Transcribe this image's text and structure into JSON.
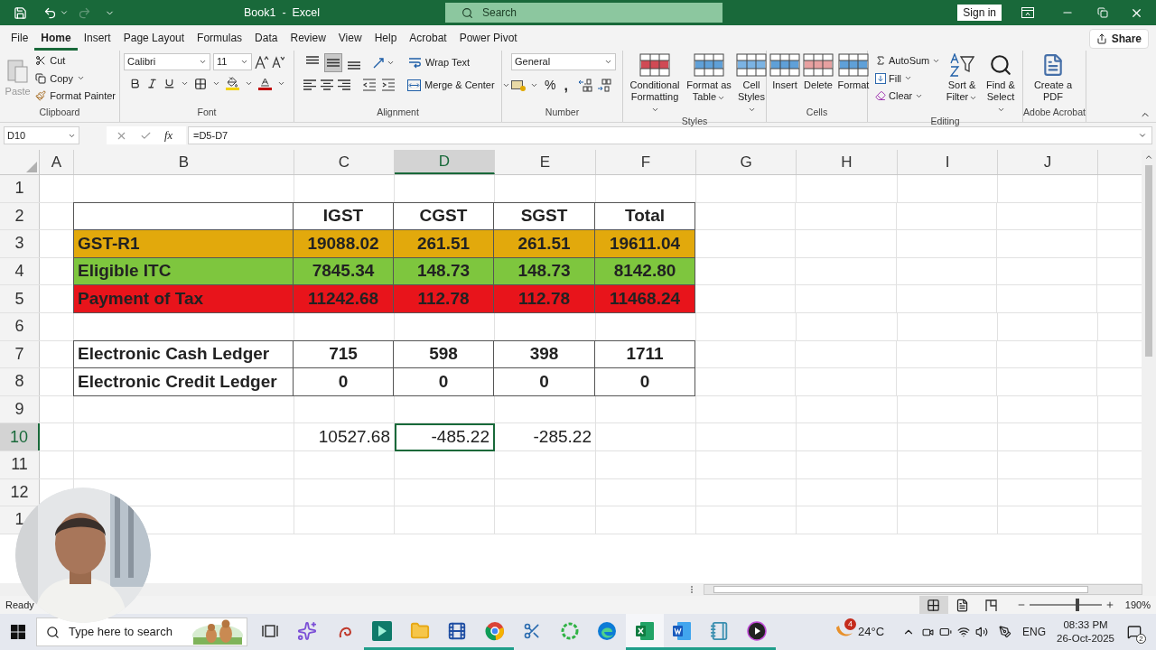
{
  "title_bar": {
    "title": "Book1  -  Excel",
    "search": "Search",
    "sign_in": "Sign in",
    "redo_disabled": true
  },
  "menu_tabs": [
    {
      "label": "File",
      "selected": false
    },
    {
      "label": "Home",
      "selected": true
    },
    {
      "label": "Insert",
      "selected": false
    },
    {
      "label": "Page Layout",
      "selected": false
    },
    {
      "label": "Formulas",
      "selected": false
    },
    {
      "label": "Data",
      "selected": false
    },
    {
      "label": "Review",
      "selected": false
    },
    {
      "label": "View",
      "selected": false
    },
    {
      "label": "Help",
      "selected": false
    },
    {
      "label": "Acrobat",
      "selected": false
    },
    {
      "label": "Power Pivot",
      "selected": false
    }
  ],
  "share": "Share",
  "ribbon": {
    "clipboard": {
      "paste": "Paste",
      "cut": "Cut",
      "copy": "Copy",
      "format_painter": "Format Painter",
      "label": "Clipboard"
    },
    "font": {
      "name": "Calibri",
      "size": "11",
      "label": "Font"
    },
    "alignment": {
      "vertical": [
        {
          "kind": "top",
          "selected": false
        },
        {
          "kind": "middle",
          "selected": true
        },
        {
          "kind": "bottom",
          "selected": false
        }
      ],
      "wrap": "Wrap Text",
      "merge": "Merge & Center",
      "label": "Alignment"
    },
    "number": {
      "format": "General",
      "percent": "%",
      "comma": ",",
      "label": "Number"
    },
    "styles": {
      "conditional": "Conditional Formatting",
      "format_table": "Format as Table",
      "cell_styles": "Cell Styles",
      "label": "Styles"
    },
    "cells": {
      "insert": "Insert",
      "delete": "Delete",
      "format": "Format",
      "label": "Cells"
    },
    "editing": {
      "autosum": "AutoSum",
      "fill": "Fill",
      "clear": "Clear",
      "sort": "Sort & Filter",
      "find": "Find & Select",
      "label": "Editing"
    },
    "acrobat": {
      "create": "Create a PDF",
      "label": "Adobe Acrobat"
    }
  },
  "formula_bar": {
    "name_box": "D10",
    "fx": "fx",
    "formula": "=D5-D7"
  },
  "sheet": {
    "columns": [
      {
        "label": "A",
        "selected": false
      },
      {
        "label": "B",
        "selected": false
      },
      {
        "label": "C",
        "selected": false
      },
      {
        "label": "D",
        "selected": true
      },
      {
        "label": "E",
        "selected": false
      },
      {
        "label": "F",
        "selected": false
      },
      {
        "label": "G",
        "selected": false
      },
      {
        "label": "H",
        "selected": false
      },
      {
        "label": "I",
        "selected": false
      },
      {
        "label": "J",
        "selected": false
      }
    ],
    "rows": [
      {
        "number": "1",
        "selected": false,
        "bordered": false
      },
      {
        "number": "2",
        "selected": false,
        "bordered": true,
        "cells": [
          {
            "text": "IGST",
            "kind": "value",
            "selected": false
          },
          {
            "text": "CGST",
            "kind": "value",
            "selected": false
          },
          {
            "text": "SGST",
            "kind": "value",
            "selected": false
          },
          {
            "text": "Total",
            "kind": "value",
            "selected": false
          }
        ]
      },
      {
        "number": "3",
        "selected": false,
        "bordered": true,
        "color": "#e2a90c",
        "label": "GST-R1",
        "cells": [
          {
            "text": "19088.02",
            "kind": "value",
            "selected": false
          },
          {
            "text": "261.51",
            "kind": "value",
            "selected": false
          },
          {
            "text": "261.51",
            "kind": "value",
            "selected": false
          },
          {
            "text": "19611.04",
            "kind": "value",
            "selected": false
          }
        ]
      },
      {
        "number": "4",
        "selected": false,
        "bordered": true,
        "color": "#7ec63e",
        "label": "Eligible ITC",
        "cells": [
          {
            "text": "7845.34",
            "kind": "value",
            "selected": false
          },
          {
            "text": "148.73",
            "kind": "value",
            "selected": false
          },
          {
            "text": "148.73",
            "kind": "value",
            "selected": false
          },
          {
            "text": "8142.80",
            "kind": "value",
            "selected": false
          }
        ]
      },
      {
        "number": "5",
        "selected": false,
        "bordered": true,
        "color": "#e8141b",
        "label": "Payment of Tax",
        "cells": [
          {
            "text": "11242.68",
            "kind": "value",
            "selected": false
          },
          {
            "text": "112.78",
            "kind": "value",
            "selected": false
          },
          {
            "text": "112.78",
            "kind": "value",
            "selected": false
          },
          {
            "text": "11468.24",
            "kind": "value",
            "selected": false
          }
        ]
      },
      {
        "number": "6",
        "selected": false,
        "bordered": false
      },
      {
        "number": "7",
        "selected": false,
        "bordered": true,
        "label": "Electronic Cash Ledger",
        "cells": [
          {
            "text": "715",
            "kind": "value",
            "selected": false
          },
          {
            "text": "598",
            "kind": "value",
            "selected": false
          },
          {
            "text": "398",
            "kind": "value",
            "selected": false
          },
          {
            "text": "1711",
            "kind": "value",
            "selected": false
          }
        ]
      },
      {
        "number": "8",
        "selected": false,
        "bordered": true,
        "label": "Electronic Credit Ledger",
        "cells": [
          {
            "text": "0",
            "kind": "value",
            "selected": false
          },
          {
            "text": "0",
            "kind": "value",
            "selected": false
          },
          {
            "text": "0",
            "kind": "value",
            "selected": false
          },
          {
            "text": "0",
            "kind": "value",
            "selected": false
          }
        ]
      },
      {
        "number": "9",
        "selected": false,
        "bordered": false
      },
      {
        "number": "10",
        "selected": true,
        "bordered": false,
        "cells": [
          {
            "text": "10527.68",
            "kind": "number",
            "selected": false
          },
          {
            "text": "-485.22",
            "kind": "number",
            "selected": true
          },
          {
            "text": "-285.22",
            "kind": "number",
            "selected": false
          }
        ]
      },
      {
        "number": "11",
        "selected": false,
        "bordered": false
      },
      {
        "number": "12",
        "selected": false,
        "bordered": false
      },
      {
        "number": "1",
        "selected": false,
        "bordered": false
      }
    ]
  },
  "status_bar": {
    "status": "Ready",
    "views": [
      {
        "kind": "normal",
        "selected": true
      },
      {
        "kind": "page_layout",
        "selected": false
      },
      {
        "kind": "page_break",
        "selected": false
      }
    ],
    "zoom": {
      "level": 0.66
    },
    "zoom_label": "190%"
  },
  "taskbar": {
    "search_placeholder": "Type here to search",
    "apps": [
      {
        "kind": "task_view",
        "running": false,
        "selected": false
      },
      {
        "kind": "copilot",
        "running": false,
        "selected": false
      },
      {
        "kind": "swirl",
        "running": false,
        "selected": false
      },
      {
        "kind": "video_editor",
        "running": true,
        "selected": false
      },
      {
        "kind": "folder",
        "running": true,
        "selected": false
      },
      {
        "kind": "media",
        "running": true,
        "selected": false
      },
      {
        "kind": "browser",
        "running": true,
        "selected": false
      },
      {
        "kind": "snip",
        "running": false,
        "selected": false
      },
      {
        "kind": "ring",
        "running": false,
        "selected": false
      },
      {
        "kind": "edge",
        "running": false,
        "selected": false
      },
      {
        "kind": "spreadsheet",
        "running": true,
        "selected": true
      },
      {
        "kind": "document",
        "running": true,
        "selected": false
      },
      {
        "kind": "notepad",
        "running": true,
        "selected": false
      },
      {
        "kind": "player",
        "running": true,
        "selected": false
      }
    ],
    "weather_badge": "4",
    "temperature": "24°C",
    "language": "ENG",
    "time": "08:33 PM",
    "date": "26-Oct-2025",
    "notifications": "2"
  }
}
